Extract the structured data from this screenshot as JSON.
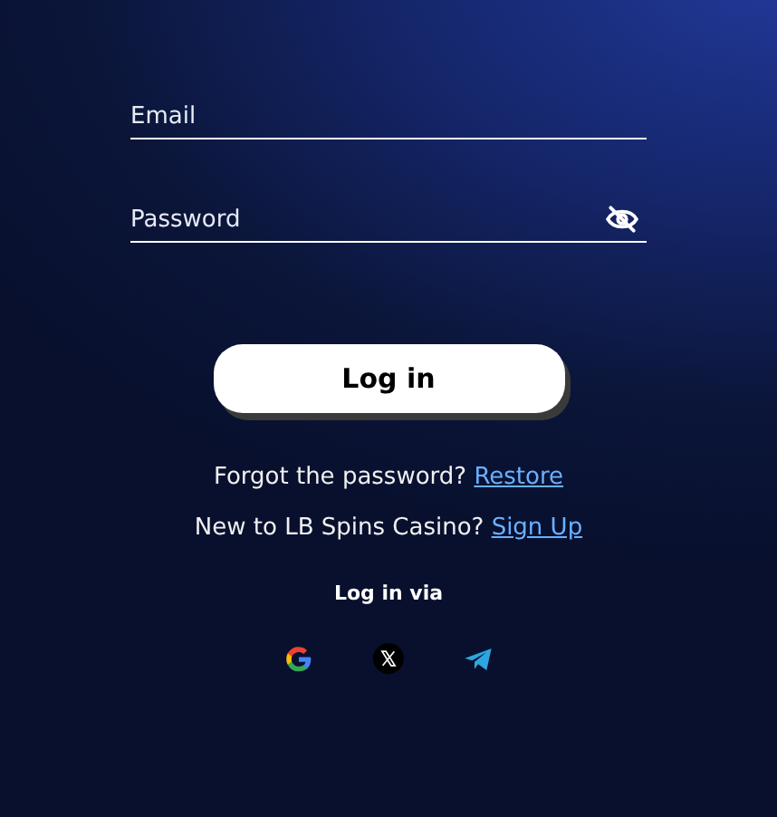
{
  "form": {
    "email": {
      "placeholder": "Email"
    },
    "password": {
      "placeholder": "Password",
      "visible": false
    },
    "submit": "Log in",
    "restore": {
      "text": "Forgot the password?",
      "link": "Restore"
    },
    "signup": {
      "text": "New to LB Spins Casino?",
      "link": "Sign Up"
    },
    "social": {
      "label": "Log in via",
      "providers": [
        {
          "kind": "google"
        },
        {
          "kind": "x"
        },
        {
          "kind": "telegram"
        }
      ]
    }
  }
}
